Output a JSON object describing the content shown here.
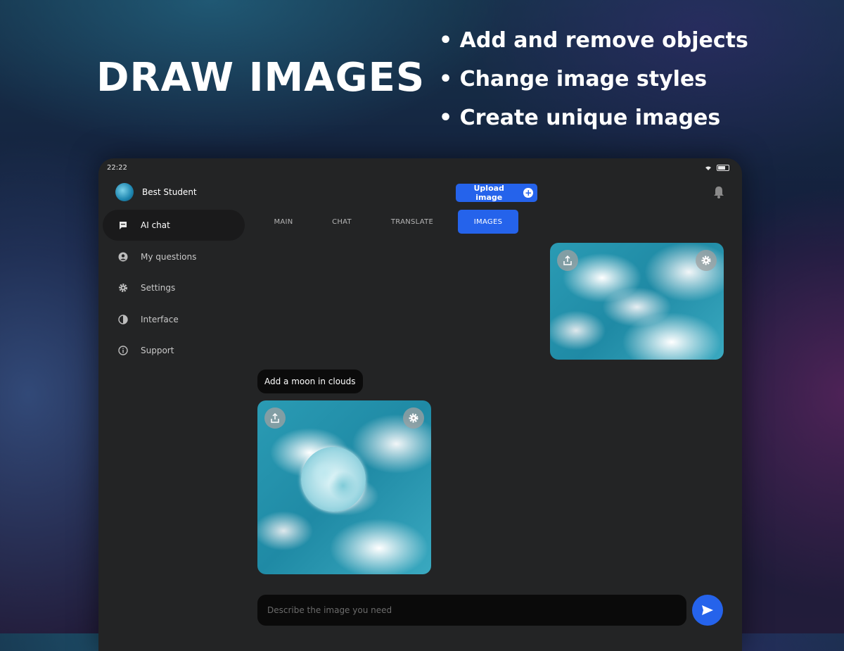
{
  "hero": {
    "title": "DRAW IMAGES",
    "bullets": [
      "Add and remove objects",
      "Change image styles",
      "Create unique images"
    ]
  },
  "status_bar": {
    "time": "22:22"
  },
  "profile": {
    "name": "Best Student"
  },
  "sidebar": {
    "items": [
      {
        "label": "AI chat",
        "icon": "chat-bubble-icon",
        "active": true
      },
      {
        "label": "My questions",
        "icon": "user-circle-icon",
        "active": false
      },
      {
        "label": "Settings",
        "icon": "gear-icon",
        "active": false
      },
      {
        "label": "Interface",
        "icon": "contrast-icon",
        "active": false
      },
      {
        "label": "Support",
        "icon": "info-icon",
        "active": false
      }
    ]
  },
  "header": {
    "upload_label": "Upload image",
    "upload_icon": "plus-circle-icon",
    "bell_icon": "bell-icon"
  },
  "tabs": [
    {
      "label": "MAIN",
      "active": false
    },
    {
      "label": "CHAT",
      "active": false
    },
    {
      "label": "TRANSLATE",
      "active": false
    },
    {
      "label": "IMAGES",
      "active": true
    }
  ],
  "conversation": {
    "prompt": "Add a moon in clouds"
  },
  "composer": {
    "placeholder": "Describe the image you need"
  },
  "colors": {
    "accent": "#2563eb",
    "panel": "#232425",
    "input_bg": "#0a0a0a"
  }
}
